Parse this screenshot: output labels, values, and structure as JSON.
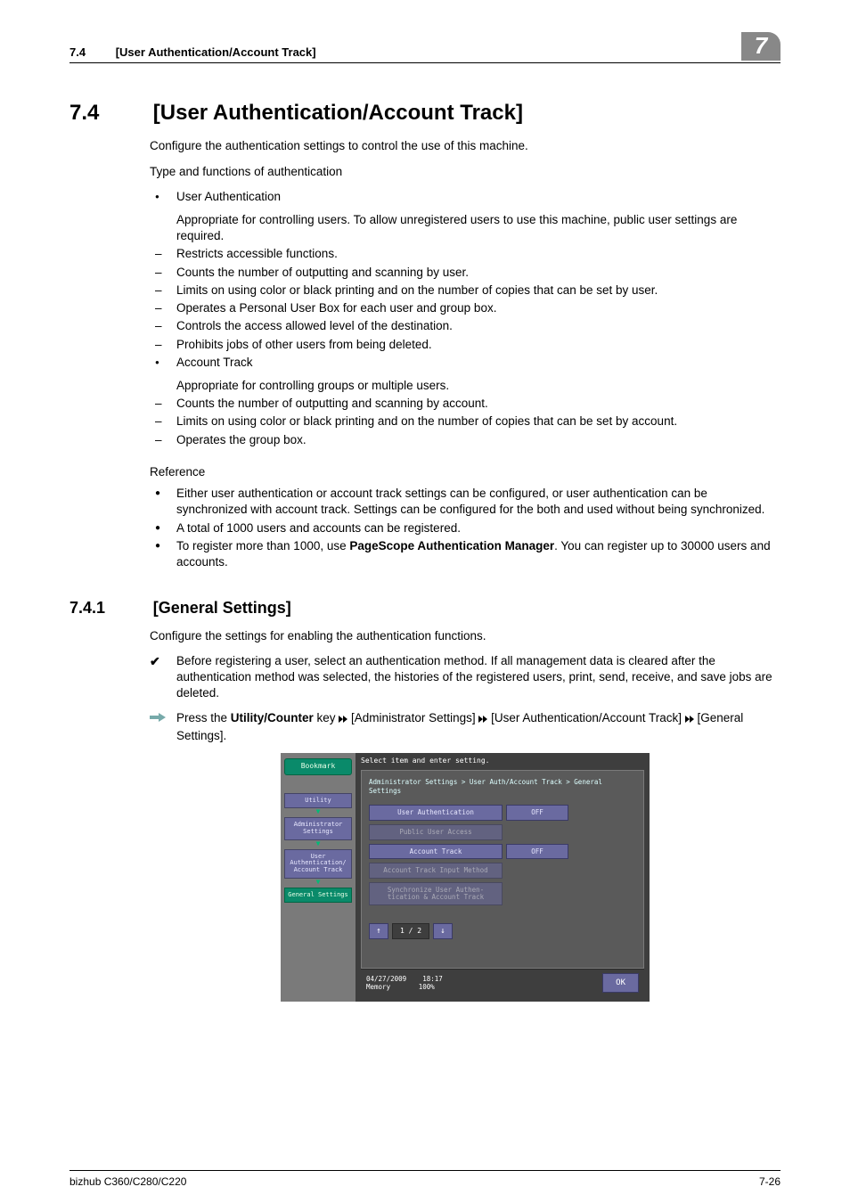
{
  "header": {
    "section_num": "7.4",
    "section_title": "[User Authentication/Account Track]",
    "chapter_badge": "7"
  },
  "h2": {
    "num": "7.4",
    "title": "[User Authentication/Account Track]"
  },
  "intro1": "Configure the authentication settings to control the use of this machine.",
  "intro2": "Type and functions of authentication",
  "list1": {
    "i0": "User Authentication",
    "i0b": "Appropriate for controlling users. To allow unregistered users to use this machine, public user settings are required.",
    "i1": "Restricts accessible functions.",
    "i2": "Counts the number of outputting and scanning by user.",
    "i3": "Limits on using color or black printing and on the number of copies that can be set by user.",
    "i4": "Operates a Personal User Box for each user and group box.",
    "i5": "Controls the access allowed level of the destination.",
    "i6": "Prohibits jobs of other users from being deleted.",
    "i7": "Account Track",
    "i7b": "Appropriate for controlling groups or multiple users.",
    "i8": "Counts the number of outputting and scanning by account.",
    "i9": "Limits on using color or black printing and on the number of copies that can be set by account.",
    "i10": "Operates the group box."
  },
  "ref": {
    "heading": "Reference",
    "r0": "Either user authentication or account track settings can be configured, or user authentication can be synchronized with account track. Settings can be configured for the both and used without being synchronized.",
    "r1": "A total of 1000 users and accounts can be registered.",
    "r2a": "To register more than 1000, use ",
    "r2b": "PageScope Authentication Manager",
    "r2c": ". You can register up to 30000 users and accounts."
  },
  "h3": {
    "num": "7.4.1",
    "title": "[General Settings]"
  },
  "s741": {
    "p1": "Configure the settings for enabling the authentication functions.",
    "tick": "Before registering a user, select an authentication method. If all management data is cleared after the authentication method was selected, the histories of the registered users, print, send, receive, and save jobs are deleted.",
    "arrow_a": "Press the ",
    "arrow_b": "Utility/Counter",
    "arrow_c": " key ",
    "arrow_d": " [Administrator Settings] ",
    "arrow_e": " [User Authentication/Account Track] ",
    "arrow_f": " [General Settings]."
  },
  "shot": {
    "instruct": "Select item and enter setting.",
    "bookmark": "Bookmark",
    "crumb": "Administrator Settings > User Auth/Account Track  > General Settings",
    "side": {
      "utility": "Utility",
      "admin": "Administrator Settings",
      "uauth": "User Authentication/ Account Track",
      "gen": "General Settings"
    },
    "rows": {
      "r0l": "User Authentication",
      "r0v": "OFF",
      "r1l": "Public User Access",
      "r2l": "Account Track",
      "r2v": "OFF",
      "r3l": "Account Track Input Method",
      "r4l": "Synchronize User Authen- tication & Account Track"
    },
    "pager": "1 / 2",
    "date": "04/27/2009",
    "time": "18:17",
    "mem_l": "Memory",
    "mem_v": "100%",
    "ok": "OK"
  },
  "footer": {
    "left": "bizhub C360/C280/C220",
    "right": "7-26"
  }
}
